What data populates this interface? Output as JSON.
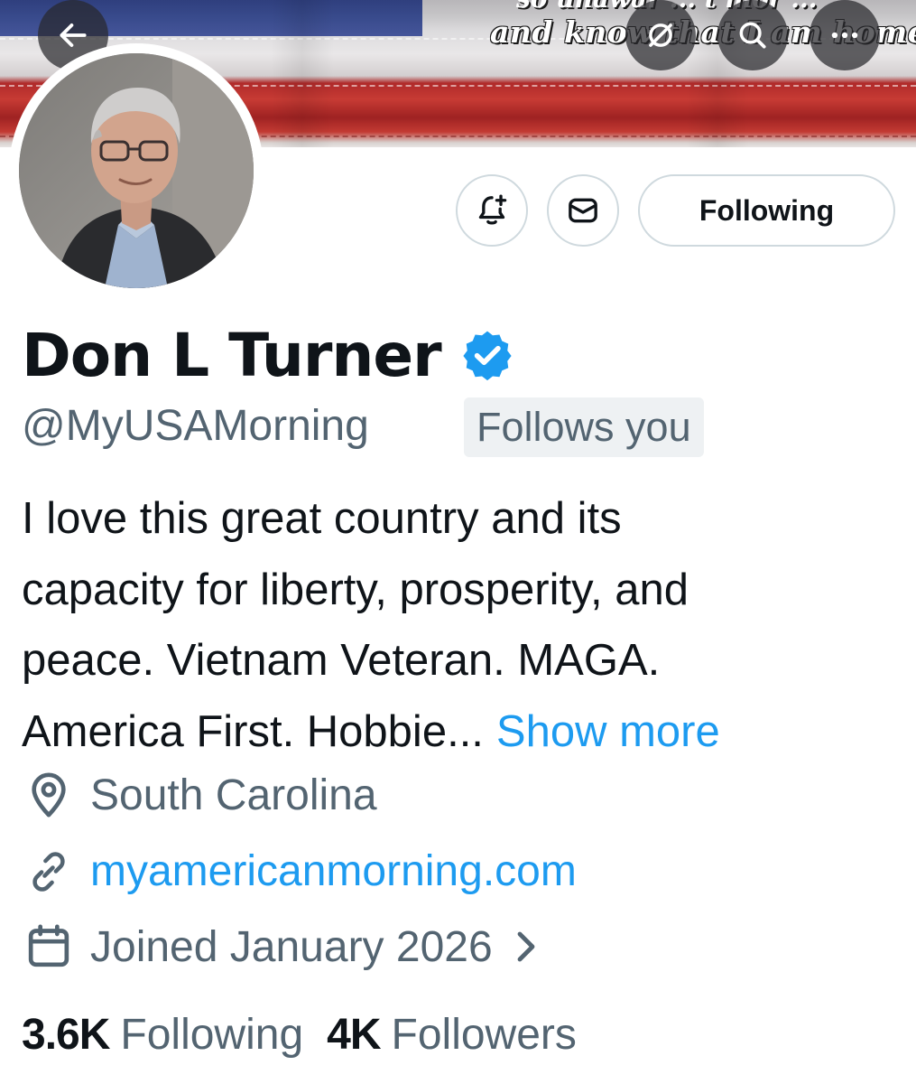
{
  "banner": {
    "quote_top": "so  unawar  ...  t  mor  ...",
    "quote": "and know that I am home"
  },
  "header_actions": {
    "back": "back-arrow-icon",
    "cast": "cast-icon",
    "search": "search-icon",
    "more": "more-icon"
  },
  "profile": {
    "display_name": "Don L Turner",
    "verified": true,
    "handle": "@MyUSAMorning",
    "follows_you_label": "Follows you",
    "bio_lines": [
      "I love this great country and its",
      "capacity for liberty, prosperity, and",
      "peace. Vietnam Veteran. MAGA.",
      "America First. Hobbie..."
    ],
    "show_more_label": "Show more",
    "location": "South Carolina",
    "website": "myamericanmorning.com",
    "joined": "Joined January 2026"
  },
  "actions": {
    "following_label": "Following"
  },
  "stats": {
    "following_count": "3.6K",
    "following_label": "Following",
    "followers_count": "4K",
    "followers_label": "Followers"
  },
  "colors": {
    "accent": "#1d9bf0",
    "secondary_text": "#536471",
    "primary_text": "#0f1419",
    "border": "#cfd9de"
  }
}
